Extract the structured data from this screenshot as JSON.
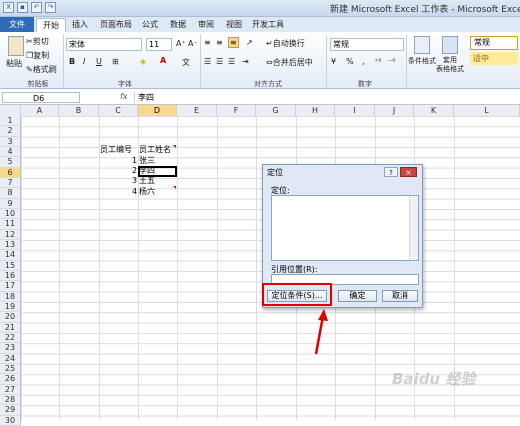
{
  "window": {
    "title": "新建 Microsoft Excel 工作表 - Microsoft Excel"
  },
  "tabs": [
    "文件",
    "开始",
    "插入",
    "页面布局",
    "公式",
    "数据",
    "审阅",
    "视图",
    "开发工具"
  ],
  "ribbon": {
    "paste": "粘贴",
    "cut": "剪切",
    "copy": "复制",
    "format_painter": "格式刷",
    "font_name": "宋体",
    "font_size": "11",
    "bold": "B",
    "italic": "I",
    "underline": "U",
    "wrap_text": "自动换行",
    "merge_center": "合并后居中",
    "number_format": "常规",
    "percent": "%",
    "comma": ",",
    "conditional_format": "条件格式",
    "table_format": "套用\n表格格式",
    "style_normal": "常规",
    "style_neutral": "适中",
    "group_clipboard": "剪贴板",
    "group_font": "字体",
    "group_alignment": "对齐方式",
    "group_number": "数字"
  },
  "formula_bar": {
    "name_box": "D6",
    "fx": "fx",
    "content": "李四"
  },
  "columns": [
    "A",
    "B",
    "C",
    "D",
    "E",
    "F",
    "G",
    "H",
    "I",
    "J",
    "K",
    "L"
  ],
  "selected_column": "D",
  "rows": [
    "1",
    "2",
    "3",
    "4",
    "5",
    "6",
    "7",
    "8",
    "9",
    "10",
    "11",
    "12",
    "13",
    "14",
    "15",
    "16",
    "17",
    "18",
    "19",
    "20",
    "21",
    "22",
    "23",
    "24",
    "25",
    "26",
    "27",
    "28",
    "29",
    "30"
  ],
  "selected_row": "6",
  "cells": {
    "header_id": "员工编号",
    "header_name": "员工姓名",
    "ids": [
      "1",
      "2",
      "3",
      "4"
    ],
    "names": [
      "张三",
      "李四",
      "王五",
      "杨六"
    ]
  },
  "dialog": {
    "title": "定位",
    "help": "?",
    "close": "×",
    "goto_label": "定位:",
    "reference_label": "引用位置(R):",
    "reference_value": "",
    "special_button": "定位条件(S)...",
    "ok_button": "确定",
    "cancel_button": "取消"
  },
  "annotation_color": "#e10000",
  "watermark": "Baidu 经验"
}
